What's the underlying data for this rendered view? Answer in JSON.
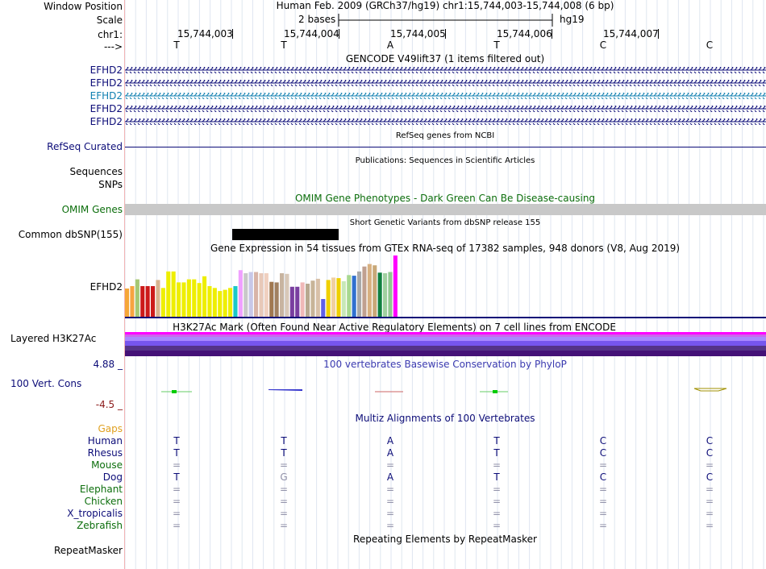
{
  "header": {
    "window_position_label": "Window Position",
    "scale_label": "Scale",
    "chr_label": "chr1:",
    "arrow_label": "--->",
    "assembly_and_position": "Human Feb. 2009 (GRCh37/hg19)   chr1:15,744,003-15,744,008 (6 bp)",
    "scale_text": "2 bases",
    "scale_db": "hg19",
    "positions": [
      "15,744,003",
      "15,744,004",
      "15,744,005",
      "15,744,006",
      "15,744,007"
    ],
    "bases": [
      "T",
      "T",
      "A",
      "T",
      "C",
      "C"
    ]
  },
  "gencode": {
    "title": "GENCODE V49lift37 (1 items filtered out)",
    "genes": [
      {
        "name": "EFHD2",
        "color": "#0c0c78"
      },
      {
        "name": "EFHD2",
        "color": "#0c0c78"
      },
      {
        "name": "EFHD2",
        "color": "#0f7fb0"
      },
      {
        "name": "EFHD2",
        "color": "#0c0c78"
      },
      {
        "name": "EFHD2",
        "color": "#0c0c78"
      }
    ]
  },
  "refseq": {
    "title": "RefSeq genes from NCBI",
    "label": "RefSeq Curated",
    "color": "#0c0c78"
  },
  "publications": {
    "title": "Publications: Sequences in Scientific Articles",
    "labels": [
      "Sequences",
      "SNPs"
    ]
  },
  "omim": {
    "title": "OMIM Gene Phenotypes - Dark Green Can Be Disease-causing",
    "label": "OMIM Genes",
    "color": "#0c6e0c"
  },
  "dbsnp": {
    "title": "Short Genetic Variants from dbSNP release 155",
    "label": "Common dbSNP(155)"
  },
  "gtex": {
    "title": "Gene Expression in 54 tissues from GTEx RNA-seq of 17382 samples, 948 donors (V8, Aug 2019)",
    "label": "EFHD2",
    "bar_colors": [
      "#f5a637",
      "#f7a440",
      "#a6c873",
      "#cc1a1a",
      "#cc1a1a",
      "#cc1a1a",
      "#d8b48f",
      "#eeee00",
      "#eeee00",
      "#eeee00",
      "#eeee00",
      "#eeee00",
      "#eeee00",
      "#eeee00",
      "#eeee00",
      "#eeee00",
      "#eeee00",
      "#eeee00",
      "#eeee00",
      "#eeee00",
      "#eeee00",
      "#1ac8c8",
      "#f0a0ff",
      "#c8c8c8",
      "#c8c8e8",
      "#d8b4a8",
      "#e8c8b8",
      "#f0d0c0",
      "#a07850",
      "#a08060",
      "#c8b4a0",
      "#d8c8b8",
      "#7a3fa0",
      "#7a3fa0",
      "#f0b8b8",
      "#b8a890",
      "#c8b498",
      "#d8c0a8",
      "#6060e8",
      "#f0d000",
      "#f0d0a0",
      "#eed000",
      "#c8e8b8",
      "#a8d890",
      "#3070d0",
      "#a8a8a8",
      "#c0a090",
      "#d8b080",
      "#c8a878",
      "#108040",
      "#a0d0a0",
      "#90c890",
      "#ff00ff"
    ],
    "bar_values": [
      0.46,
      0.5,
      0.61,
      0.5,
      0.5,
      0.5,
      0.6,
      0.47,
      0.74,
      0.74,
      0.56,
      0.56,
      0.61,
      0.61,
      0.55,
      0.66,
      0.5,
      0.47,
      0.42,
      0.44,
      0.47,
      0.5,
      0.76,
      0.71,
      0.73,
      0.73,
      0.71,
      0.71,
      0.57,
      0.56,
      0.71,
      0.7,
      0.49,
      0.49,
      0.56,
      0.54,
      0.59,
      0.62,
      0.29,
      0.6,
      0.64,
      0.63,
      0.58,
      0.68,
      0.67,
      0.74,
      0.82,
      0.86,
      0.84,
      0.72,
      0.71,
      0.73,
      1.0
    ]
  },
  "h3k27ac": {
    "title": "H3K27Ac Mark (Often Found Near Active Regulatory Elements) on 7 cell lines from ENCODE",
    "label": "Layered H3K27Ac",
    "band_colors": [
      "#ff00ff",
      "#cc66ee",
      "#aa88ff",
      "#7755ee",
      "#553388",
      "#441177"
    ]
  },
  "phylop": {
    "title": "100 vertebrates Basewise Conservation by PhyloP",
    "label": "100 Vert. Cons",
    "max": "4.88 _",
    "min": "-4.5 _"
  },
  "multiz": {
    "title": "Multiz Alignments of 100 Vertebrates",
    "gaps_label": "Gaps",
    "species": [
      {
        "name": "Human",
        "color": "#0c0c78",
        "bases": [
          "T",
          "T",
          "A",
          "T",
          "C",
          "C"
        ]
      },
      {
        "name": "Rhesus",
        "color": "#0c0c78",
        "bases": [
          "T",
          "T",
          "A",
          "T",
          "C",
          "C"
        ]
      },
      {
        "name": "Mouse",
        "color": "#0c6e0c",
        "bases": [
          "=",
          "=",
          "=",
          "=",
          "=",
          "="
        ]
      },
      {
        "name": "Dog",
        "color": "#0c0c78",
        "bases": [
          "T",
          "G",
          "A",
          "T",
          "C",
          "C"
        ]
      },
      {
        "name": "Elephant",
        "color": "#0c6e0c",
        "bases": [
          "=",
          "=",
          "=",
          "=",
          "=",
          "="
        ]
      },
      {
        "name": "Chicken",
        "color": "#0c6e0c",
        "bases": [
          "=",
          "=",
          "=",
          "=",
          "=",
          "="
        ]
      },
      {
        "name": "X_tropicalis",
        "color": "#0c0c78",
        "bases": [
          "=",
          "=",
          "=",
          "=",
          "=",
          "="
        ]
      },
      {
        "name": "Zebrafish",
        "color": "#0c6e0c",
        "bases": [
          "=",
          "=",
          "=",
          "=",
          "=",
          "="
        ]
      }
    ]
  },
  "repeatmasker": {
    "title": "Repeating Elements by RepeatMasker",
    "label": "RepeatMasker"
  }
}
